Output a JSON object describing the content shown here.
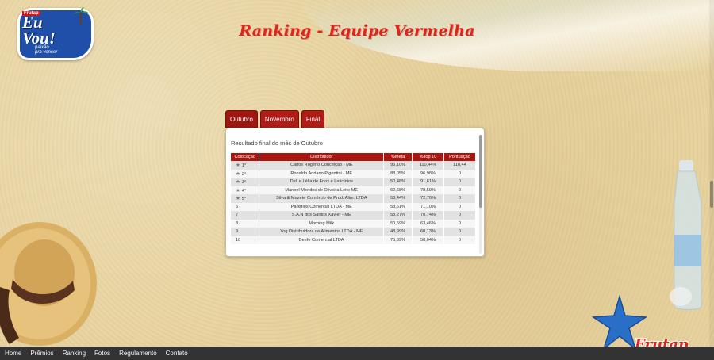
{
  "logo": {
    "brand_small": "Frutap",
    "main_line1": "Eu",
    "main_line2": "Vou!",
    "tagline_line1": "paixão",
    "tagline_line2": "pra vencer"
  },
  "page_title": "Ranking - Equipe Vermelha",
  "tabs": [
    {
      "label": "Outubro",
      "active": true
    },
    {
      "label": "Novembro",
      "active": false
    },
    {
      "label": "Final",
      "active": false
    }
  ],
  "panel": {
    "caption": "Resultado final do mês de Outubro",
    "columns": [
      "Colocação",
      "Distribuidor",
      "%Meta",
      "%Top 10",
      "Pontuação"
    ],
    "rows": [
      {
        "pos": "1°",
        "dist": "Carlos Rogério Conceição - ME",
        "meta": "96,10%",
        "top": "110,44%",
        "pont": "110,44",
        "star": true
      },
      {
        "pos": "2°",
        "dist": "Ronaldo Adriano Pigentini - ME",
        "meta": "88,05%",
        "top": "96,98%",
        "pont": "0",
        "star": true
      },
      {
        "pos": "3°",
        "dist": "Didi e Lélia de Frios e Laticínios",
        "meta": "50,48%",
        "top": "91,61%",
        "pont": "0",
        "star": true
      },
      {
        "pos": "4°",
        "dist": "Manoel Mendes de Oliveira Leite ME",
        "meta": "62,68%",
        "top": "78,59%",
        "pont": "0",
        "star": true
      },
      {
        "pos": "5°",
        "dist": "Silva & Mazete Comércio de Prod. Alim. LTDA",
        "meta": "53,44%",
        "top": "72,70%",
        "pont": "0",
        "star": true
      },
      {
        "pos": "6",
        "dist": "Parkfrios Comercial LTDA - ME",
        "meta": "58,61%",
        "top": "71,10%",
        "pont": "0",
        "star": false
      },
      {
        "pos": "7",
        "dist": "S.A.N dos Santos Xavier - ME",
        "meta": "58,27%",
        "top": "70,74%",
        "pont": "0",
        "star": false
      },
      {
        "pos": "8",
        "dist": "Morning Milk",
        "meta": "50,59%",
        "top": "63,46%",
        "pont": "0",
        "star": false
      },
      {
        "pos": "9",
        "dist": "Yog Distribuidora de Alimentos LTDA - ME",
        "meta": "48,99%",
        "top": "60,13%",
        "pont": "0",
        "star": false
      },
      {
        "pos": "10",
        "dist": "Beefe Comercial LTDA",
        "meta": "75,89%",
        "top": "58,04%",
        "pont": "0",
        "star": false
      }
    ]
  },
  "footer_nav": [
    "Home",
    "Prêmios",
    "Ranking",
    "Fotos",
    "Regulamento",
    "Contato"
  ],
  "brand_logo": "Frutap",
  "colors": {
    "accent": "#a9150f",
    "title": "#e2231a",
    "footer": "#333333"
  }
}
